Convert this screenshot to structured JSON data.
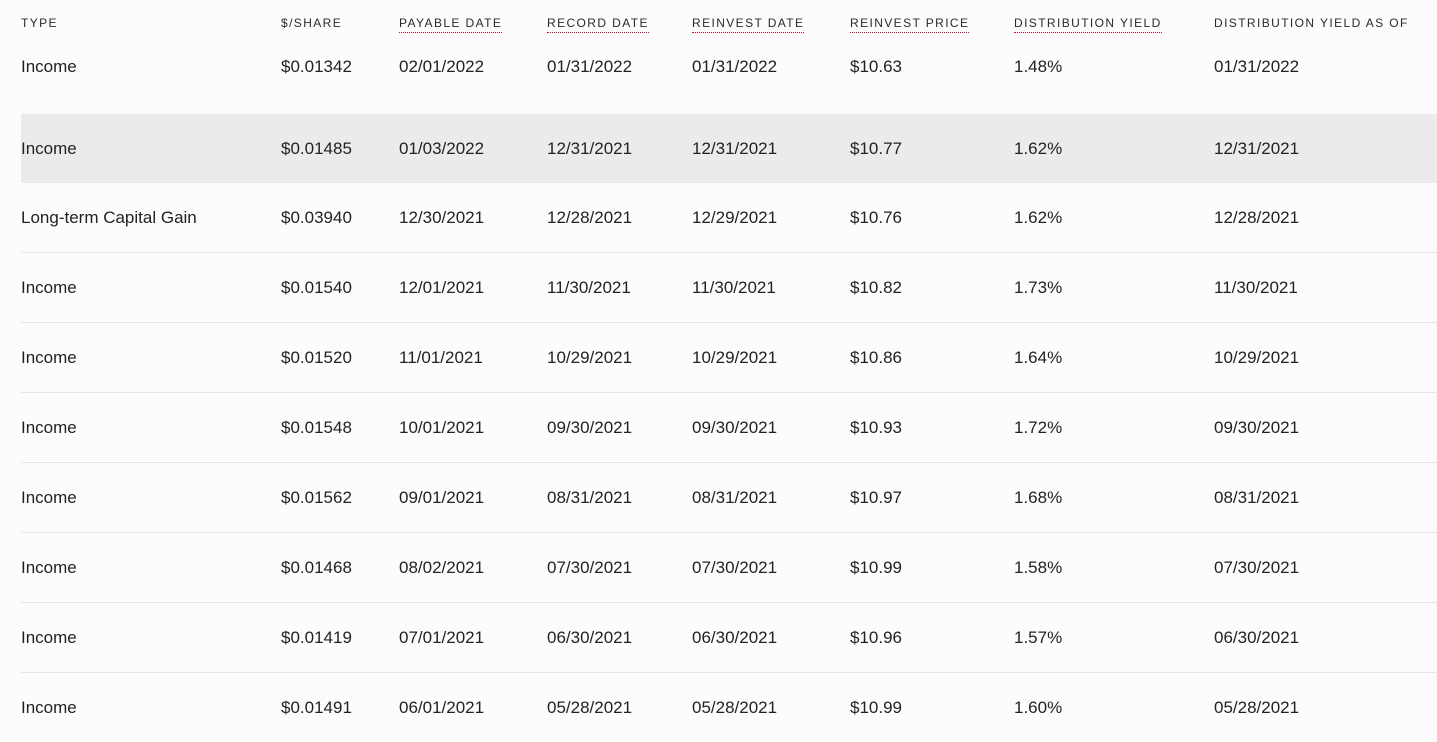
{
  "table": {
    "headers": [
      "TYPE",
      "$/SHARE",
      "PAYABLE DATE",
      "RECORD DATE",
      "REINVEST DATE",
      "REINVEST PRICE",
      "DISTRIBUTION YIELD",
      "DISTRIBUTION YIELD AS OF"
    ],
    "rows": [
      [
        "Income",
        "$0.01342",
        "02/01/2022",
        "01/31/2022",
        "01/31/2022",
        "$10.63",
        "1.48%",
        "01/31/2022"
      ],
      [
        "Income",
        "$0.01485",
        "01/03/2022",
        "12/31/2021",
        "12/31/2021",
        "$10.77",
        "1.62%",
        "12/31/2021"
      ],
      [
        "Long-term Capital Gain",
        "$0.03940",
        "12/30/2021",
        "12/28/2021",
        "12/29/2021",
        "$10.76",
        "1.62%",
        "12/28/2021"
      ],
      [
        "Income",
        "$0.01540",
        "12/01/2021",
        "11/30/2021",
        "11/30/2021",
        "$10.82",
        "1.73%",
        "11/30/2021"
      ],
      [
        "Income",
        "$0.01520",
        "11/01/2021",
        "10/29/2021",
        "10/29/2021",
        "$10.86",
        "1.64%",
        "10/29/2021"
      ],
      [
        "Income",
        "$0.01548",
        "10/01/2021",
        "09/30/2021",
        "09/30/2021",
        "$10.93",
        "1.72%",
        "09/30/2021"
      ],
      [
        "Income",
        "$0.01562",
        "09/01/2021",
        "08/31/2021",
        "08/31/2021",
        "$10.97",
        "1.68%",
        "08/31/2021"
      ],
      [
        "Income",
        "$0.01468",
        "08/02/2021",
        "07/30/2021",
        "07/30/2021",
        "$10.99",
        "1.58%",
        "07/30/2021"
      ],
      [
        "Income",
        "$0.01419",
        "07/01/2021",
        "06/30/2021",
        "06/30/2021",
        "$10.96",
        "1.57%",
        "06/30/2021"
      ],
      [
        "Income",
        "$0.01491",
        "06/01/2021",
        "05/28/2021",
        "05/28/2021",
        "$10.99",
        "1.60%",
        "05/28/2021"
      ]
    ]
  },
  "colors": {
    "tooltip_underline": "#c8102e",
    "row_highlight": "#ebebeb",
    "divider": "#e6e6e6"
  }
}
